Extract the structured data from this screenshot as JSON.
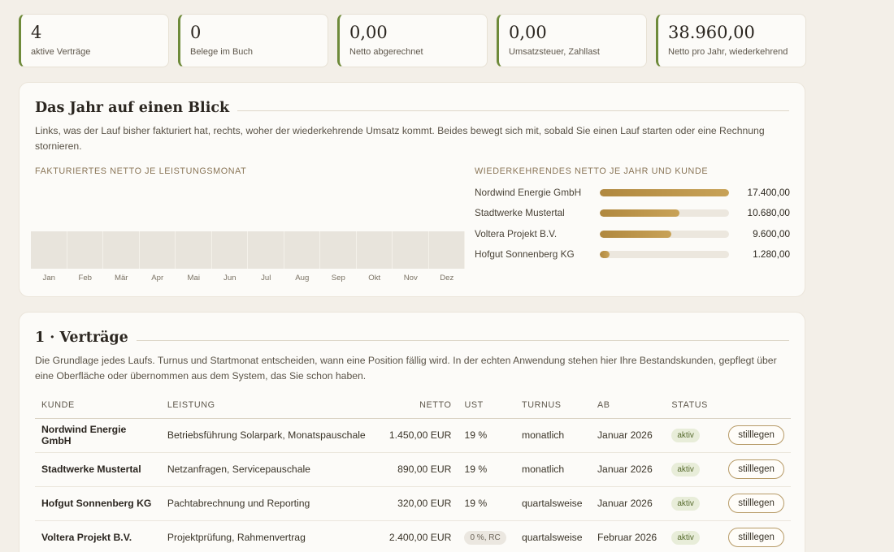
{
  "stats": [
    {
      "value": "4",
      "label": "aktive Verträge"
    },
    {
      "value": "0",
      "label": "Belege im Buch"
    },
    {
      "value": "0,00",
      "label": "Netto abgerechnet"
    },
    {
      "value": "0,00",
      "label": "Umsatzsteuer, Zahllast"
    },
    {
      "value": "38.960,00",
      "label": "Netto pro Jahr, wiederkehrend"
    }
  ],
  "overview": {
    "title": "Das Jahr auf einen Blick",
    "description": "Links, was der Lauf bisher fakturiert hat, rechts, woher der wiederkehrende Umsatz kommt. Beides bewegt sich mit, sobald Sie einen Lauf starten oder eine Rechnung stornieren.",
    "monthly_label": "FAKTURIERTES NETTO JE LEISTUNGSMONAT",
    "recurring_label": "WIEDERKEHRENDES NETTO JE JAHR UND KUNDE"
  },
  "chart_data": [
    {
      "type": "bar",
      "categories": [
        "Jan",
        "Feb",
        "Mär",
        "Apr",
        "Mai",
        "Jun",
        "Jul",
        "Aug",
        "Sep",
        "Okt",
        "Nov",
        "Dez"
      ],
      "values": [
        0,
        0,
        0,
        0,
        0,
        0,
        0,
        0,
        0,
        0,
        0,
        0
      ],
      "title": "FAKTURIERTES NETTO JE LEISTUNGSMONAT"
    },
    {
      "type": "bar",
      "orientation": "horizontal",
      "categories": [
        "Nordwind Energie GmbH",
        "Stadtwerke Mustertal",
        "Voltera Projekt B.V.",
        "Hofgut Sonnenberg KG"
      ],
      "values": [
        17400,
        10680,
        9600,
        1280
      ],
      "value_labels": [
        "17.400,00",
        "10.680,00",
        "9.600,00",
        "1.280,00"
      ],
      "title": "WIEDERKEHRENDES NETTO JE JAHR UND KUNDE"
    }
  ],
  "contracts": {
    "title": "1 · Verträge",
    "description": "Die Grundlage jedes Laufs. Turnus und Startmonat entscheiden, wann eine Position fällig wird. In der echten Anwendung stehen hier Ihre Bestandskunden, gepflegt über eine Oberfläche oder übernommen aus dem System, das Sie schon haben.",
    "headers": {
      "kunde": "KUNDE",
      "leistung": "LEISTUNG",
      "netto": "NETTO",
      "ust": "UST",
      "turnus": "TURNUS",
      "ab": "AB",
      "status": "STATUS"
    },
    "rows": [
      {
        "kunde": "Nordwind Energie GmbH",
        "leistung": "Betriebsführung Solarpark, Monatspauschale",
        "netto": "1.450,00 EUR",
        "ust": "19 %",
        "ust_badge": false,
        "turnus": "monatlich",
        "ab": "Januar 2026",
        "status": "aktiv",
        "action": "stilllegen"
      },
      {
        "kunde": "Stadtwerke Mustertal",
        "leistung": "Netzanfragen, Servicepauschale",
        "netto": "890,00 EUR",
        "ust": "19 %",
        "ust_badge": false,
        "turnus": "monatlich",
        "ab": "Januar 2026",
        "status": "aktiv",
        "action": "stilllegen"
      },
      {
        "kunde": "Hofgut Sonnenberg KG",
        "leistung": "Pachtabrechnung und Reporting",
        "netto": "320,00 EUR",
        "ust": "19 %",
        "ust_badge": false,
        "turnus": "quartalsweise",
        "ab": "Januar 2026",
        "status": "aktiv",
        "action": "stilllegen"
      },
      {
        "kunde": "Voltera Projekt B.V.",
        "leistung": "Projektprüfung, Rahmenvertrag",
        "netto": "2.400,00 EUR",
        "ust": "0 %, RC",
        "ust_badge": true,
        "turnus": "quartalsweise",
        "ab": "Februar 2026",
        "status": "aktiv",
        "action": "stilllegen"
      }
    ]
  }
}
